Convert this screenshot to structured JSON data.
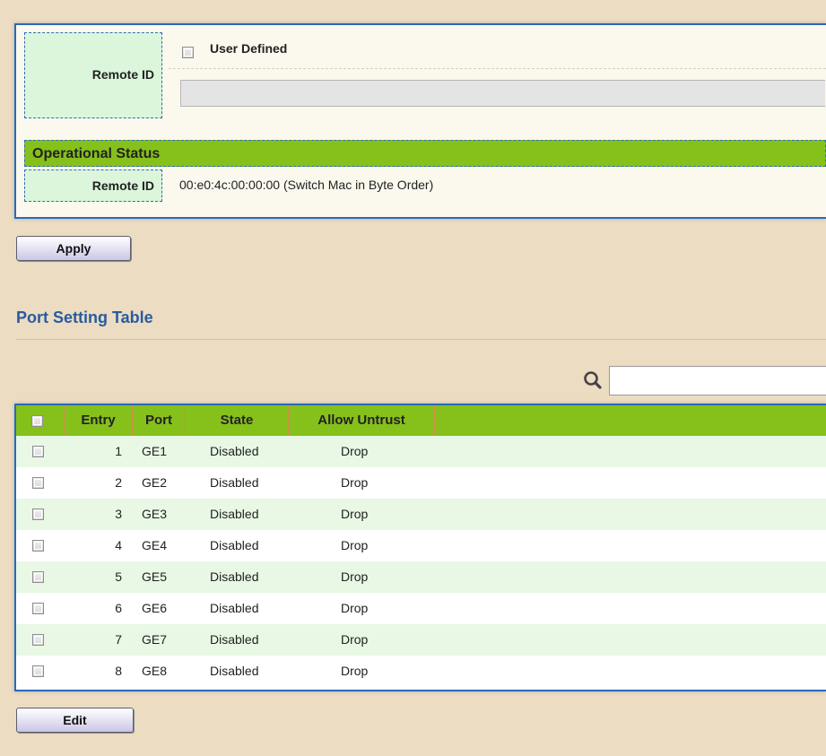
{
  "remote_id_section": {
    "label": "Remote ID",
    "user_defined_label": "User Defined",
    "user_defined_checked": false,
    "remote_id_value": "",
    "remote_id_placeholder": ""
  },
  "operational_status": {
    "title": "Operational Status",
    "remote_id_label": "Remote ID",
    "remote_id_value": "00:e0:4c:00:00:00 (Switch Mac in Byte Order)"
  },
  "buttons": {
    "apply": "Apply",
    "edit": "Edit"
  },
  "port_table": {
    "title": "Port Setting Table",
    "search_value": "",
    "search_icon": "search-icon",
    "columns": [
      "Entry",
      "Port",
      "State",
      "Allow Untrust"
    ],
    "rows": [
      {
        "entry": "1",
        "port": "GE1",
        "state": "Disabled",
        "allow_untrust": "Drop"
      },
      {
        "entry": "2",
        "port": "GE2",
        "state": "Disabled",
        "allow_untrust": "Drop"
      },
      {
        "entry": "3",
        "port": "GE3",
        "state": "Disabled",
        "allow_untrust": "Drop"
      },
      {
        "entry": "4",
        "port": "GE4",
        "state": "Disabled",
        "allow_untrust": "Drop"
      },
      {
        "entry": "5",
        "port": "GE5",
        "state": "Disabled",
        "allow_untrust": "Drop"
      },
      {
        "entry": "6",
        "port": "GE6",
        "state": "Disabled",
        "allow_untrust": "Drop"
      },
      {
        "entry": "7",
        "port": "GE7",
        "state": "Disabled",
        "allow_untrust": "Drop"
      },
      {
        "entry": "8",
        "port": "GE8",
        "state": "Disabled",
        "allow_untrust": "Drop"
      }
    ]
  },
  "colors": {
    "header_green": "#86c01b",
    "panel_border_blue": "#2a69b6",
    "label_cell_green": "#dbf6db",
    "row_alt_green": "#e8f8e5",
    "title_blue": "#2a5b9e",
    "page_background": "#ebdcc2"
  }
}
